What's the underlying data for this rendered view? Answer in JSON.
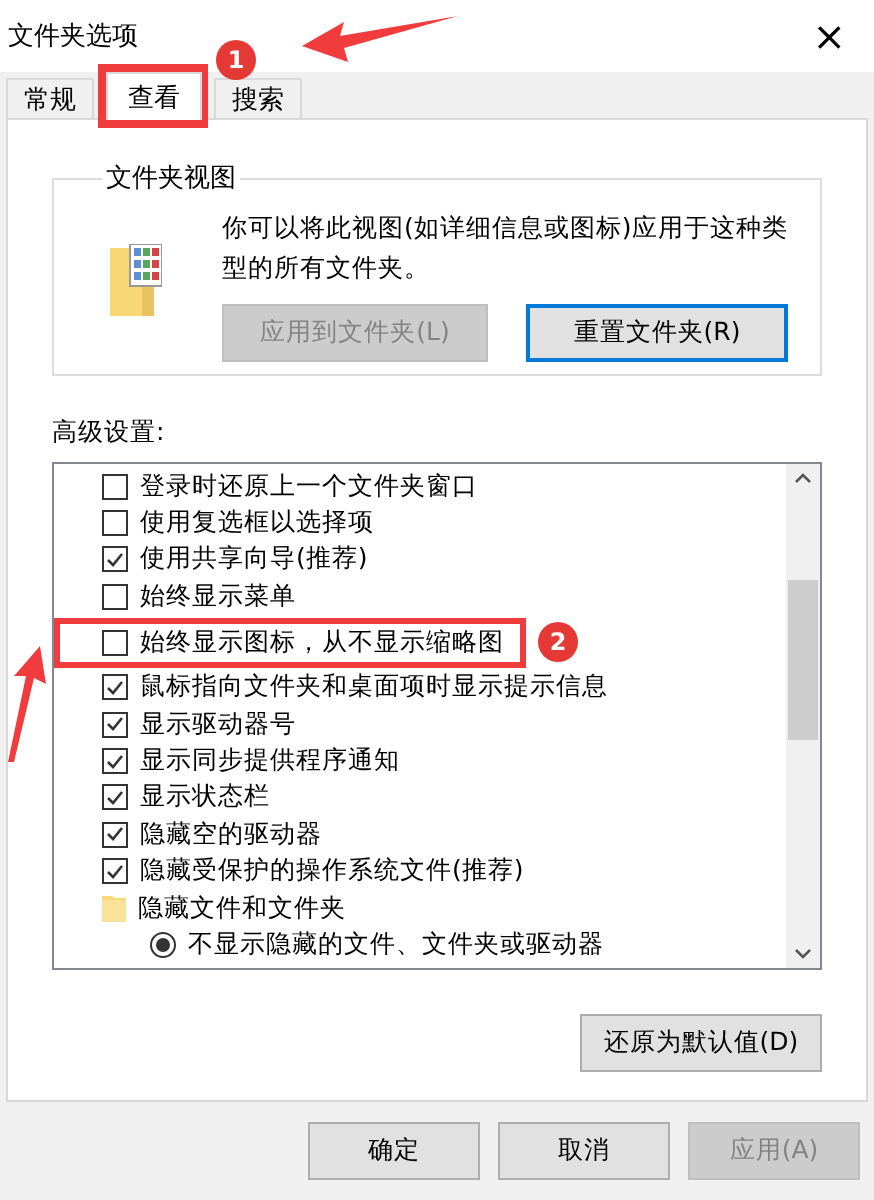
{
  "window": {
    "title": "文件夹选项",
    "close": "×"
  },
  "tabs": [
    {
      "label": "常规",
      "selected": false
    },
    {
      "label": "查看",
      "selected": true,
      "callout": "1"
    },
    {
      "label": "搜索",
      "selected": false
    }
  ],
  "folder_views": {
    "title": "文件夹视图",
    "description": "你可以将此视图(如详细信息或图标)应用于这种类型的所有文件夹。",
    "buttons": [
      {
        "label": "应用到文件夹(L)",
        "disabled": true,
        "focused": false
      },
      {
        "label": "重置文件夹(R)",
        "disabled": false,
        "focused": true
      }
    ]
  },
  "advanced": {
    "label": "高级设置:",
    "items": [
      {
        "kind": "checkbox",
        "label": "登录时还原上一个文件夹窗口",
        "checked": false
      },
      {
        "kind": "checkbox",
        "label": "使用复选框以选择项",
        "checked": false
      },
      {
        "kind": "checkbox",
        "label": "使用共享向导(推荐)",
        "checked": true
      },
      {
        "kind": "checkbox",
        "label": "始终显示菜单",
        "checked": false
      },
      {
        "kind": "checkbox",
        "label": "始终显示图标，从不显示缩略图",
        "checked": false,
        "callout": "2"
      },
      {
        "kind": "checkbox",
        "label": "鼠标指向文件夹和桌面项时显示提示信息",
        "checked": true
      },
      {
        "kind": "checkbox",
        "label": "显示驱动器号",
        "checked": true
      },
      {
        "kind": "checkbox",
        "label": "显示同步提供程序通知",
        "checked": true
      },
      {
        "kind": "checkbox",
        "label": "显示状态栏",
        "checked": true
      },
      {
        "kind": "checkbox",
        "label": "隐藏空的驱动器",
        "checked": true
      },
      {
        "kind": "checkbox",
        "label": "隐藏受保护的操作系统文件(推荐)",
        "checked": true
      },
      {
        "kind": "folder",
        "label": "隐藏文件和文件夹"
      },
      {
        "kind": "radio",
        "label": "不显示隐藏的文件、文件夹或驱动器",
        "selected": true
      }
    ],
    "restore_button": "还原为默认值(D)"
  },
  "footer_buttons": [
    {
      "label": "确定",
      "disabled": false
    },
    {
      "label": "取消",
      "disabled": false
    },
    {
      "label": "应用(A)",
      "disabled": true
    }
  ]
}
